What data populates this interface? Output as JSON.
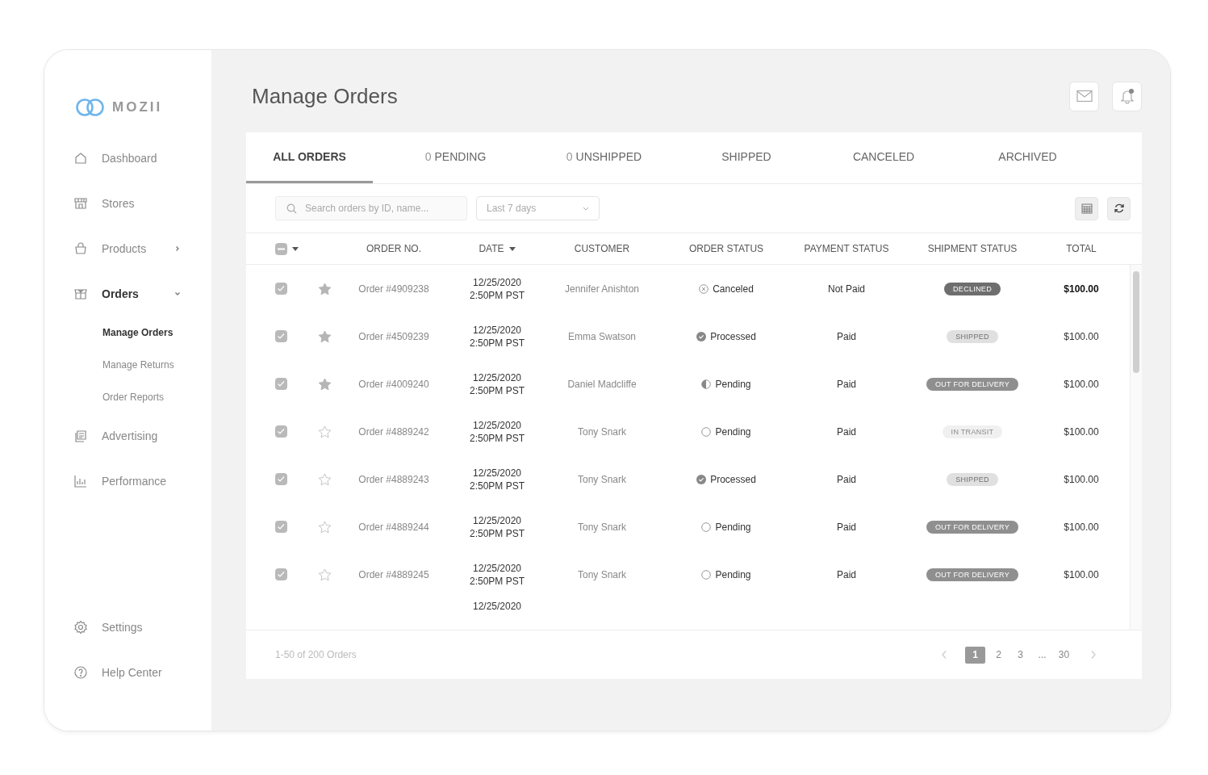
{
  "brand": {
    "name": "MOZII"
  },
  "sidebar": {
    "items": [
      {
        "label": "Dashboard",
        "selected": false
      },
      {
        "label": "Stores",
        "selected": false
      },
      {
        "label": "Products",
        "selected": false,
        "expanded": false
      },
      {
        "label": "Orders",
        "selected": true,
        "expanded": true,
        "children": [
          {
            "label": "Manage Orders",
            "selected": true
          },
          {
            "label": "Manage Returns",
            "selected": false
          },
          {
            "label": "Order Reports",
            "selected": false
          }
        ]
      },
      {
        "label": "Advertising",
        "selected": false
      },
      {
        "label": "Performance",
        "selected": false
      }
    ],
    "bottom_items": [
      {
        "label": "Settings",
        "selected": false
      },
      {
        "label": "Help Center",
        "selected": false
      }
    ]
  },
  "page": {
    "title": "Manage Orders",
    "notifications_unread": true
  },
  "tabs": [
    {
      "label": "ALL ORDERS",
      "selected": true
    },
    {
      "count": "0",
      "label": "PENDING",
      "selected": false
    },
    {
      "count": "0",
      "label": "UNSHIPPED",
      "selected": false
    },
    {
      "label": "SHIPPED",
      "selected": false
    },
    {
      "label": "CANCELED",
      "selected": false
    },
    {
      "label": "ARCHIVED",
      "selected": false
    }
  ],
  "search": {
    "placeholder": "Search orders by ID, name..."
  },
  "date_filter": {
    "value": "Last 7 days"
  },
  "table": {
    "select_all_indeterminate": true,
    "columns": [
      {
        "label": "ORDER NO.",
        "sorted": false
      },
      {
        "label": "DATE",
        "sorted": true
      },
      {
        "label": "CUSTOMER",
        "sorted": false
      },
      {
        "label": "ORDER STATUS",
        "sorted": false
      },
      {
        "label": "PAYMENT STATUS",
        "sorted": false
      },
      {
        "label": "SHIPMENT STATUS",
        "sorted": false
      },
      {
        "label": "TOTAL",
        "sorted": false
      }
    ],
    "rows": [
      {
        "checked": true,
        "starred": true,
        "order": "Order #4909238",
        "date": "12/25/2020",
        "time": "2:50PM PST",
        "customer": "Jennifer Anishton",
        "order_status": {
          "label": "Canceled",
          "kind": "canceled"
        },
        "payment": "Not Paid",
        "shipment": {
          "label": "DECLINED",
          "kind": "dark"
        },
        "total": "$100.00",
        "emphasized": true
      },
      {
        "checked": true,
        "starred": true,
        "order": "Order #4509239",
        "date": "12/25/2020",
        "time": "2:50PM PST",
        "customer": "Emma Swatson",
        "order_status": {
          "label": "Processed",
          "kind": "processed"
        },
        "payment": "Paid",
        "shipment": {
          "label": "SHIPPED",
          "kind": "light"
        },
        "total": "$100.00",
        "emphasized": false
      },
      {
        "checked": true,
        "starred": true,
        "order": "Order #4009240",
        "date": "12/25/2020",
        "time": "2:50PM PST",
        "customer": "Daniel Madcliffe",
        "order_status": {
          "label": "Pending",
          "kind": "half"
        },
        "payment": "Paid",
        "shipment": {
          "label": "OUT FOR DELIVERY",
          "kind": "medium"
        },
        "total": "$100.00",
        "emphasized": false
      },
      {
        "checked": true,
        "starred": false,
        "order": "Order #4889242",
        "date": "12/25/2020",
        "time": "2:50PM PST",
        "customer": "Tony Snark",
        "order_status": {
          "label": "Pending",
          "kind": "pending"
        },
        "payment": "Paid",
        "shipment": {
          "label": "IN TRANSIT",
          "kind": "faint"
        },
        "total": "$100.00",
        "emphasized": false
      },
      {
        "checked": true,
        "starred": false,
        "order": "Order #4889243",
        "date": "12/25/2020",
        "time": "2:50PM PST",
        "customer": "Tony Snark",
        "order_status": {
          "label": "Processed",
          "kind": "processed"
        },
        "payment": "Paid",
        "shipment": {
          "label": "SHIPPED",
          "kind": "light"
        },
        "total": "$100.00",
        "emphasized": false
      },
      {
        "checked": true,
        "starred": false,
        "order": "Order #4889244",
        "date": "12/25/2020",
        "time": "2:50PM PST",
        "customer": "Tony Snark",
        "order_status": {
          "label": "Pending",
          "kind": "pending"
        },
        "payment": "Paid",
        "shipment": {
          "label": "OUT FOR DELIVERY",
          "kind": "medium"
        },
        "total": "$100.00",
        "emphasized": false
      },
      {
        "checked": true,
        "starred": false,
        "order": "Order #4889245",
        "date": "12/25/2020",
        "time": "2:50PM PST",
        "customer": "Tony Snark",
        "order_status": {
          "label": "Pending",
          "kind": "pending"
        },
        "payment": "Paid",
        "shipment": {
          "label": "OUT FOR DELIVERY",
          "kind": "medium"
        },
        "total": "$100.00",
        "emphasized": false
      },
      {
        "date": "12/25/2020"
      }
    ]
  },
  "footer": {
    "summary": "1-50 of 200 Orders",
    "pages": [
      {
        "label": "1",
        "selected": true
      },
      {
        "label": "2",
        "selected": false
      },
      {
        "label": "3",
        "selected": false
      },
      {
        "label": "...",
        "selected": false
      },
      {
        "label": "30",
        "selected": false
      }
    ]
  }
}
